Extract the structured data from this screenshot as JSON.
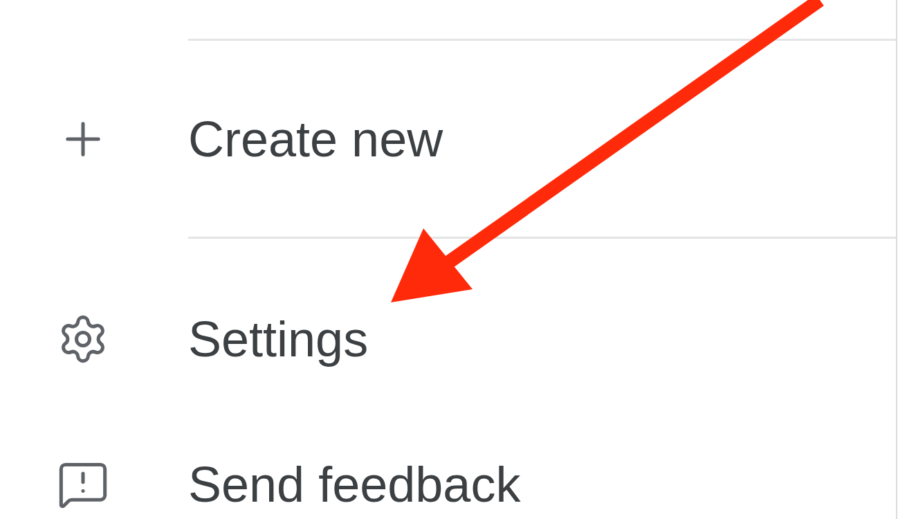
{
  "menu": {
    "items": [
      {
        "kind": "create",
        "label": "Create new",
        "divider_before": true
      },
      {
        "kind": "settings",
        "label": "Settings",
        "divider_before": true
      },
      {
        "kind": "feedback",
        "label": "Send feedback",
        "divider_before": false
      }
    ]
  }
}
